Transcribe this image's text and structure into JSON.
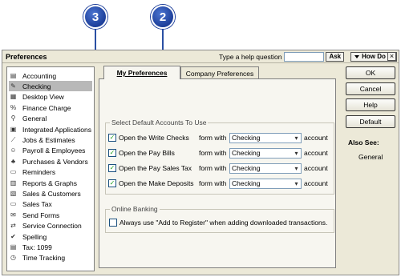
{
  "callouts": {
    "first": "3",
    "second": "2"
  },
  "window": {
    "title": "Preferences",
    "help_question": "Type a help question",
    "ask_label": "Ask",
    "how_do_i": "How Do I?",
    "close": "×"
  },
  "sidebar": {
    "items": [
      {
        "icon": "accounting-icon",
        "glyph": "▤",
        "label": "Accounting"
      },
      {
        "icon": "checking-icon",
        "glyph": "✎",
        "label": "Checking",
        "selected": true
      },
      {
        "icon": "desktop-view-icon",
        "glyph": "▦",
        "label": "Desktop View"
      },
      {
        "icon": "finance-charge-icon",
        "glyph": "%",
        "label": "Finance Charge"
      },
      {
        "icon": "general-icon",
        "glyph": "⚲",
        "label": "General"
      },
      {
        "icon": "integrated-apps-icon",
        "glyph": "▣",
        "label": "Integrated Applications"
      },
      {
        "icon": "jobs-estimates-icon",
        "glyph": "⟋",
        "label": "Jobs & Estimates"
      },
      {
        "icon": "payroll-icon",
        "glyph": "☺",
        "label": "Payroll & Employees"
      },
      {
        "icon": "purchases-icon",
        "glyph": "♣",
        "label": "Purchases & Vendors"
      },
      {
        "icon": "reminders-icon",
        "glyph": "▭",
        "label": "Reminders"
      },
      {
        "icon": "reports-icon",
        "glyph": "▥",
        "label": "Reports & Graphs"
      },
      {
        "icon": "sales-customers-icon",
        "glyph": "▧",
        "label": "Sales & Customers"
      },
      {
        "icon": "sales-tax-icon",
        "glyph": "▭",
        "label": "Sales Tax"
      },
      {
        "icon": "send-forms-icon",
        "glyph": "✉",
        "label": "Send Forms"
      },
      {
        "icon": "service-connection-icon",
        "glyph": "⇄",
        "label": "Service Connection"
      },
      {
        "icon": "spelling-icon",
        "glyph": "✔",
        "label": "Spelling"
      },
      {
        "icon": "tax-1099-icon",
        "glyph": "▤",
        "label": "Tax: 1099"
      },
      {
        "icon": "time-tracking-icon",
        "glyph": "◷",
        "label": "Time Tracking"
      }
    ]
  },
  "tabs": {
    "my": "My Preferences",
    "company": "Company Preferences"
  },
  "default_accounts": {
    "title": "Select Default Accounts To Use",
    "form_with": "form with",
    "account": "account",
    "rows": [
      {
        "label": "Open the Write Checks",
        "checked": true,
        "value": "Checking"
      },
      {
        "label": "Open the Pay Bills",
        "checked": true,
        "value": "Checking"
      },
      {
        "label": "Open the Pay Sales Tax",
        "checked": true,
        "value": "Checking"
      },
      {
        "label": "Open the Make Deposits",
        "checked": true,
        "value": "Checking"
      }
    ]
  },
  "online_banking": {
    "title": "Online Banking",
    "option": "Always use \"Add to Register\" when adding downloaded transactions.",
    "checked": false
  },
  "buttons": {
    "ok": "OK",
    "cancel": "Cancel",
    "help": "Help",
    "default": "Default"
  },
  "also_see": {
    "title": "Also See:",
    "link": "General"
  }
}
